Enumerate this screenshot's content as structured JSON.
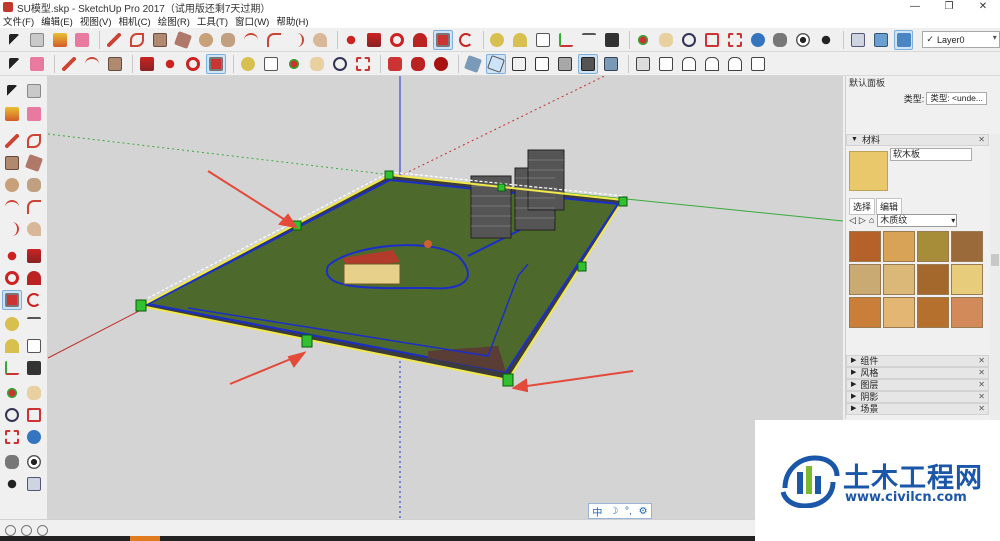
{
  "window": {
    "title": "SU模型.skp - SketchUp Pro 2017（试用版还剩7天过期）",
    "min": "—",
    "max": "❐",
    "close": "✕"
  },
  "menu": [
    "文件(F)",
    "编辑(E)",
    "视图(V)",
    "相机(C)",
    "绘图(R)",
    "工具(T)",
    "窗口(W)",
    "帮助(H)"
  ],
  "layer": {
    "check": "✓",
    "value": "Layer0"
  },
  "tray": {
    "title": "默认面板",
    "type_label": "类型:",
    "type_value": "类型: <unde...",
    "materials_header": "材料",
    "material_name": "软木板",
    "tab_select": "选择",
    "tab_edit": "编辑",
    "library": "木质纹",
    "sections": [
      "组件",
      "风格",
      "图层",
      "阴影",
      "场景"
    ]
  },
  "ime": {
    "lang": "中",
    "moon": "☽",
    "dot": "°,",
    "gear": "⚙"
  },
  "watermark": {
    "title": "土木工程网",
    "url": "www.civilcn.com"
  },
  "colors": {
    "ground": "#4d6a2c",
    "selection": "#f1e84a",
    "edge_blue": "#1b2ec8",
    "arrow": "#e34a3a",
    "brand": "#1b57a8"
  },
  "swatches": [
    "#b5612a",
    "#d8a257",
    "#a78d3a",
    "#9a6a3b",
    "#c9aa73",
    "#dcb878",
    "#a4682c",
    "#e6cc7b",
    "#c97e3a",
    "#e4b674",
    "#b5702e",
    "#d28a5a"
  ]
}
